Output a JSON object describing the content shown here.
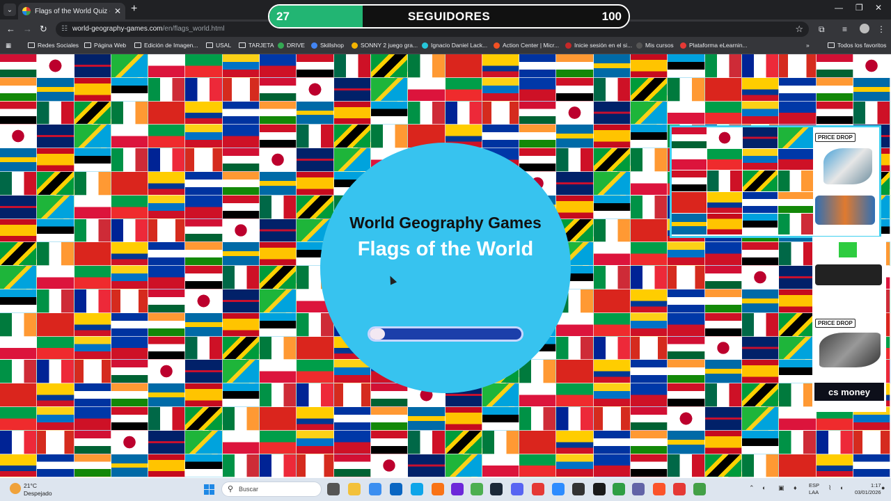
{
  "browser": {
    "tab_title": "Flags of the World Quiz - World",
    "url_host": "world-geography-games.com",
    "url_path": "/en/flags_world.html",
    "bookmarks": [
      "Redes Sociales",
      "Página Web",
      "Edición de Imagen...",
      "USAL",
      "TARJETA",
      "DRIVE",
      "Skillshop",
      "SONNY 2 juego gra...",
      "Ignacio Daniel Lack...",
      "Action Center | Micr...",
      "Inicie sesión en el si...",
      "Mis cursos",
      "Plataforma eLearnin..."
    ],
    "all_favorites": "Todos los favoritos"
  },
  "followers": {
    "current": "27",
    "label": "SEGUIDORES",
    "goal": "100",
    "progress": 0.26
  },
  "game": {
    "brand": "World Geography Games",
    "subtitle": "Flags of the World",
    "loading_progress": 0.1
  },
  "ads": {
    "badge": "PRICE DROP",
    "badge2": "PRICE DROP",
    "logo": "cs money"
  },
  "taskbar": {
    "temperature": "21°C",
    "condition": "Despejado",
    "search_placeholder": "Buscar",
    "lang_line1": "ESP",
    "lang_line2": "LAA",
    "time": "1:17",
    "date": "03/01/2026"
  },
  "colors": {
    "accent": "#37c3ef",
    "progress_bar": "#1c3faa",
    "followers_fill": "#22b573"
  }
}
